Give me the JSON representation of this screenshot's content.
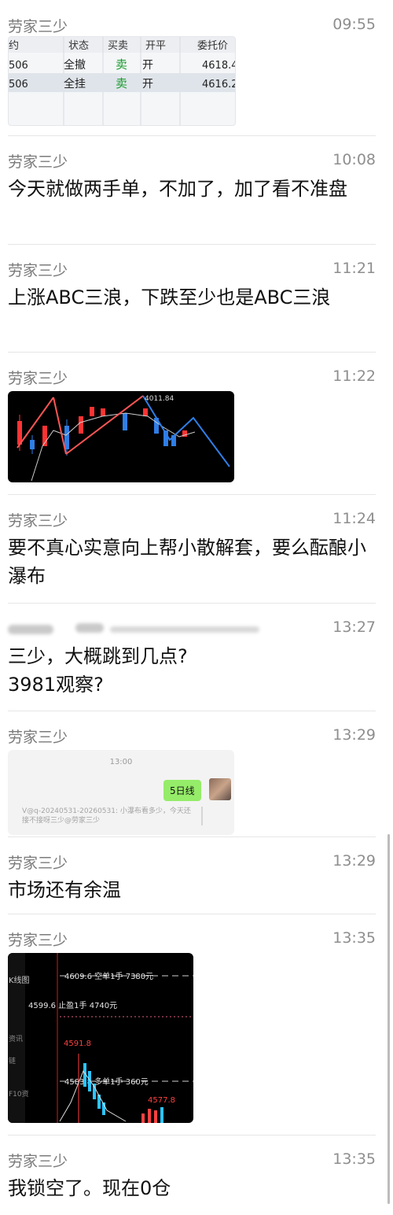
{
  "messages": [
    {
      "sender": "劳家三少",
      "time": "09:55",
      "type": "image-table"
    },
    {
      "sender": "劳家三少",
      "time": "10:08",
      "text": "今天就做两手单，不加了，加了看不准盘"
    },
    {
      "sender": "劳家三少",
      "time": "11:21",
      "text": "上涨ABC三浪，下跌至少也是ABC三浪"
    },
    {
      "sender": "劳家三少",
      "time": "11:22",
      "type": "image-chart"
    },
    {
      "sender": "劳家三少",
      "time": "11:24",
      "text": "要不真心实意向上帮小散解套，要么酝酿小瀑布"
    },
    {
      "sender": "",
      "time": "13:27",
      "line1": "三少，大概跳到几点?",
      "line2": "3981观察?"
    },
    {
      "sender": "劳家三少",
      "time": "13:29",
      "type": "image-chat"
    },
    {
      "sender": "劳家三少",
      "time": "13:29",
      "text": "市场还有余温"
    },
    {
      "sender": "劳家三少",
      "time": "13:35",
      "type": "image-kline"
    },
    {
      "sender": "劳家三少",
      "time": "13:35",
      "text": "我锁空了。现在0仓"
    }
  ],
  "table_image": {
    "headers": [
      "约",
      "状态",
      "买卖",
      "开平",
      "委托价"
    ],
    "rows": [
      [
        "506",
        "全撤",
        "卖",
        "开",
        "4618.4"
      ],
      [
        "506",
        "全挂",
        "卖",
        "开",
        "4616.2"
      ]
    ],
    "sell_color": "#1a9b2e"
  },
  "chart_image": {
    "peak_label": "4011.84",
    "up_color": "#ff3333",
    "down_color": "#2f7ee6"
  },
  "chat_image": {
    "time": "13:00",
    "bubble": "5日线",
    "quote": "V@q-20240531-20260531: 小瀑布看多少，今天还接不接呀三少@劳家三少"
  },
  "kline_image": {
    "side_tabs": [
      "K线图",
      "资讯",
      "链",
      "F10资"
    ],
    "lines": [
      {
        "label": "4609.6 空单1手 7380元"
      },
      {
        "label": "4583.8 多单1手 360元"
      }
    ],
    "stop_label": "4599.6 止盈1手 4740元",
    "price_labels": [
      "4591.8",
      "4577.8"
    ]
  }
}
